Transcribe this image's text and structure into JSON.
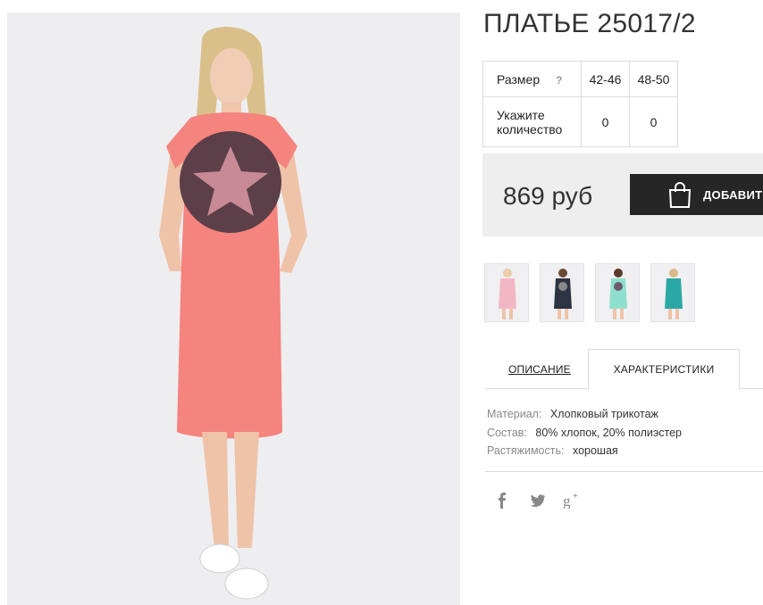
{
  "product": {
    "title": "ПЛАТЬЕ 25017/2",
    "image_alt": "dress-photo"
  },
  "size_table": {
    "size_label": "Размер",
    "help_mark": "?",
    "sizes": [
      "42-46",
      "48-50"
    ],
    "quantity_label_line1": "Укажите",
    "quantity_label_line2": "количество",
    "quantities": [
      "0",
      "0"
    ]
  },
  "price": {
    "value": "869 руб",
    "button_label": "ДОБАВИТЬ"
  },
  "thumbnails": [
    {
      "color": "pink",
      "dress_hex": "#f3b6c4"
    },
    {
      "color": "navy",
      "dress_hex": "#2c3343"
    },
    {
      "color": "mint",
      "dress_hex": "#8ee0cc"
    },
    {
      "color": "teal",
      "dress_hex": "#2aa8a6"
    }
  ],
  "tabs": {
    "description": "ОПИСАНИЕ",
    "characteristics": "ХАРАКТЕРИСТИКИ",
    "active": "characteristics"
  },
  "specs": [
    {
      "key": "Материал:",
      "value": "Хлопковый трикотаж"
    },
    {
      "key": "Состав:",
      "value": "80% хлопок, 20% полиэстер"
    },
    {
      "key": "Растяжимость:",
      "value": "хорошая"
    }
  ],
  "social": {
    "facebook": "f",
    "twitter": "twitter-bird",
    "googleplus": "g+"
  },
  "colors": {
    "dress_main": "#f5837e",
    "button_bg": "#262626",
    "price_bg": "#eeeeee"
  }
}
